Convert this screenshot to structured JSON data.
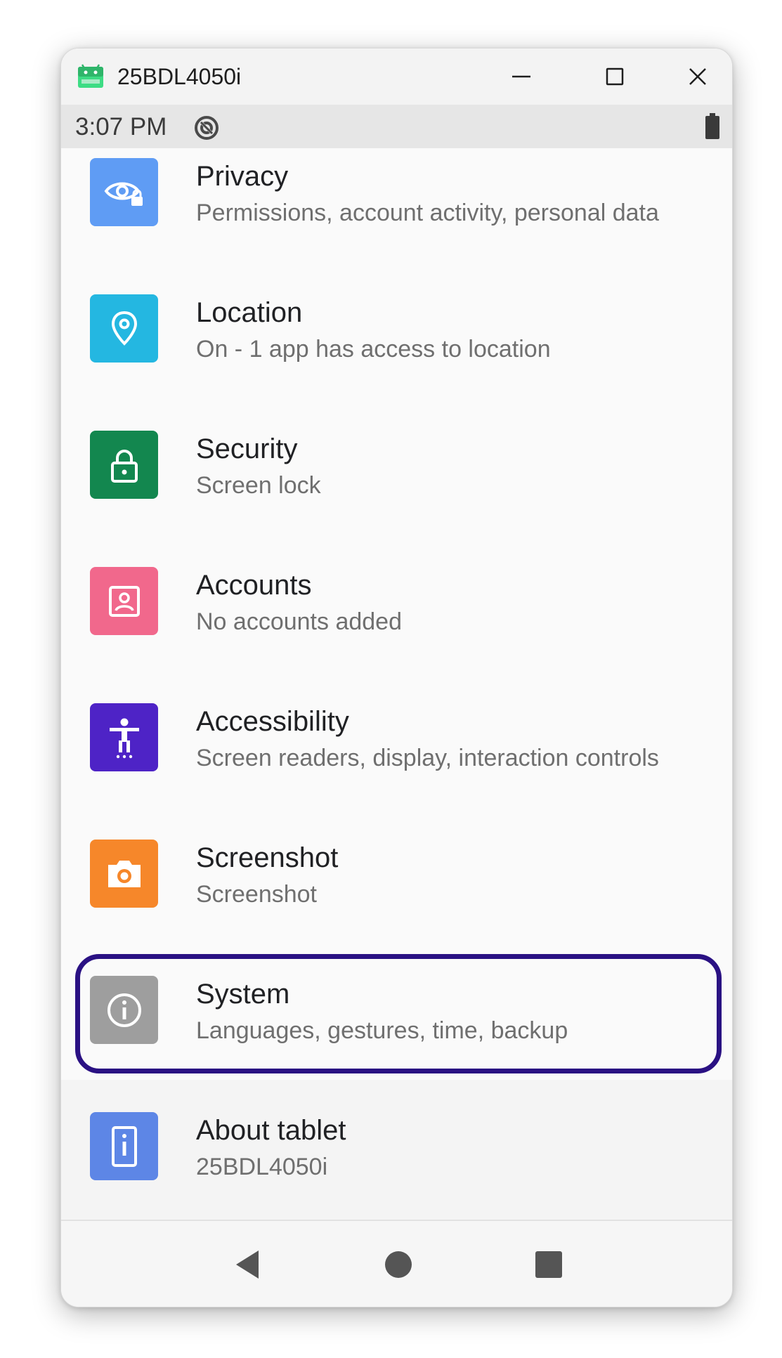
{
  "window": {
    "title": "25BDL4050i"
  },
  "status": {
    "time": "3:07 PM"
  },
  "items": [
    {
      "title": "Privacy",
      "subtitle": "Permissions, account activity, personal data",
      "icon": "privacy-icon",
      "color": "#5f9cf4"
    },
    {
      "title": "Location",
      "subtitle": "On - 1 app has access to location",
      "icon": "location-pin-icon",
      "color": "#24b7e1"
    },
    {
      "title": "Security",
      "subtitle": "Screen lock",
      "icon": "lock-icon",
      "color": "#13874f"
    },
    {
      "title": "Accounts",
      "subtitle": "No accounts added",
      "icon": "account-box-icon",
      "color": "#f1688c"
    },
    {
      "title": "Accessibility",
      "subtitle": "Screen readers, display, interaction controls",
      "icon": "accessibility-icon",
      "color": "#4e23c6"
    },
    {
      "title": "Screenshot",
      "subtitle": "Screenshot",
      "icon": "camera-icon",
      "color": "#f6872a"
    },
    {
      "title": "System",
      "subtitle": "Languages, gestures, time, backup",
      "icon": "info-icon",
      "color": "#9e9e9e"
    },
    {
      "title": "About tablet",
      "subtitle": "25BDL4050i",
      "icon": "tablet-info-icon",
      "color": "#5d86e6"
    }
  ],
  "highlight_color": "#2a1183"
}
